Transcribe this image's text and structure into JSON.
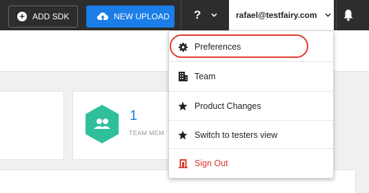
{
  "topbar": {
    "add_sdk_label": "ADD SDK",
    "new_upload_label": "NEW UPLOAD",
    "help_label": "?",
    "user_email": "rafael@testfairy.com"
  },
  "team_card": {
    "count": "1",
    "label": "TEAM MEM"
  },
  "user_menu": {
    "items": [
      {
        "label": "Preferences",
        "icon": "gear-icon"
      },
      {
        "label": "Team",
        "icon": "building-icon"
      },
      {
        "label": "Product Changes",
        "icon": "star-icon"
      },
      {
        "label": "Switch to testers view",
        "icon": "star-icon"
      },
      {
        "label": "Sign Out",
        "icon": "door-icon"
      }
    ]
  },
  "colors": {
    "topbar": "#2d2d2d",
    "primary": "#1a7de8",
    "team_hex": "#2fbf9b",
    "sign_out": "#d9372d",
    "highlight": "#e0392d"
  }
}
